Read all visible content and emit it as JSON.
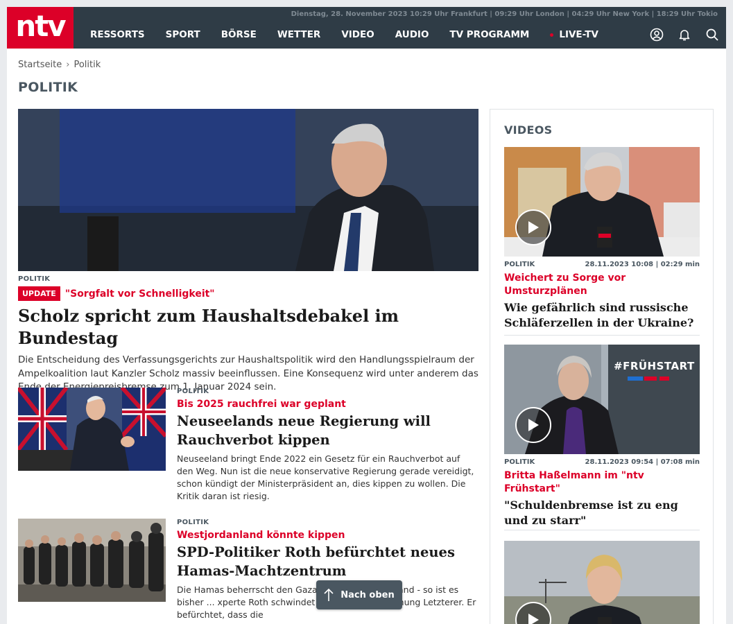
{
  "header": {
    "logo": "ntv",
    "dateline": "Dienstag, 28. November 2023 10:29 Uhr Frankfurt | 09:29 Uhr London | 04:29 Uhr New York | 18:29 Uhr Tokio",
    "nav": [
      "RESSORTS",
      "SPORT",
      "BÖRSE",
      "WETTER",
      "VIDEO",
      "AUDIO",
      "TV PROGRAMM"
    ],
    "live": "LIVE-TV",
    "icons": [
      "user-icon",
      "bell-icon",
      "search-icon"
    ],
    "colors": {
      "bar": "#2f3c46",
      "brand": "#dc0028"
    }
  },
  "breadcrumb": {
    "home": "Startseite",
    "current": "Politik"
  },
  "page_title": "POLITIK",
  "hero": {
    "kicker": "POLITIK",
    "badge": "UPDATE",
    "roofline": "\"Sorgfalt vor Schnelligkeit\"",
    "headline": "Scholz spricht zum Haushaltsdebakel im Bundestag",
    "teaser": "Die Entscheidung des Verfassungsgerichts zur Haushaltspolitik wird den Handlungsspielraum der Ampelkoalition laut Kanzler Scholz massiv beeinflussen. Eine Konsequenz wird unter anderem das Ende der Energiepreisbremse zum 1. Januar 2024 sein."
  },
  "articles": [
    {
      "kicker": "POLITIK",
      "roofline": "Bis 2025 rauchfrei war geplant",
      "headline": "Neuseelands neue Regierung will Rauchverbot kippen",
      "teaser": "Neuseeland bringt Ende 2022 ein Gesetz für ein Rauchverbot auf den Weg. Nun ist die neue konservative Regierung gerade vereidigt, schon kündigt der Ministerpräsident an, dies kippen zu wollen. Die Kritik daran ist riesig."
    },
    {
      "kicker": "POLITIK",
      "roofline": "Westjordanland könnte kippen",
      "headline": "SPD-Politiker Roth befürchtet neues Hamas-Machtzentrum",
      "teaser": "Die Hamas beherrscht den Gaza- ... as Westjordanland - so ist es bisher ... xperte Roth schwindet jedoch die Zustimmung Letzterer. Er befürchtet, dass die"
    }
  ],
  "sidebar": {
    "title": "VIDEOS",
    "videos": [
      {
        "kicker": "POLITIK",
        "meta": "28.11.2023 10:08 | 02:29 min",
        "roofline": "Weichert zu Sorge vor Umsturzplänen",
        "headline": "Wie gefährlich sind russische Schläferzellen in der Ukraine?"
      },
      {
        "kicker": "POLITIK",
        "meta": "28.11.2023 09:54 | 07:08 min",
        "roofline": "Britta Haßelmann im \"ntv Frühstart\"",
        "headline": "\"Schuldenbremse ist zu eng und zu starr\"",
        "screen_text": "#FRÜHSTART"
      },
      {}
    ]
  },
  "back_to_top": "Nach oben"
}
